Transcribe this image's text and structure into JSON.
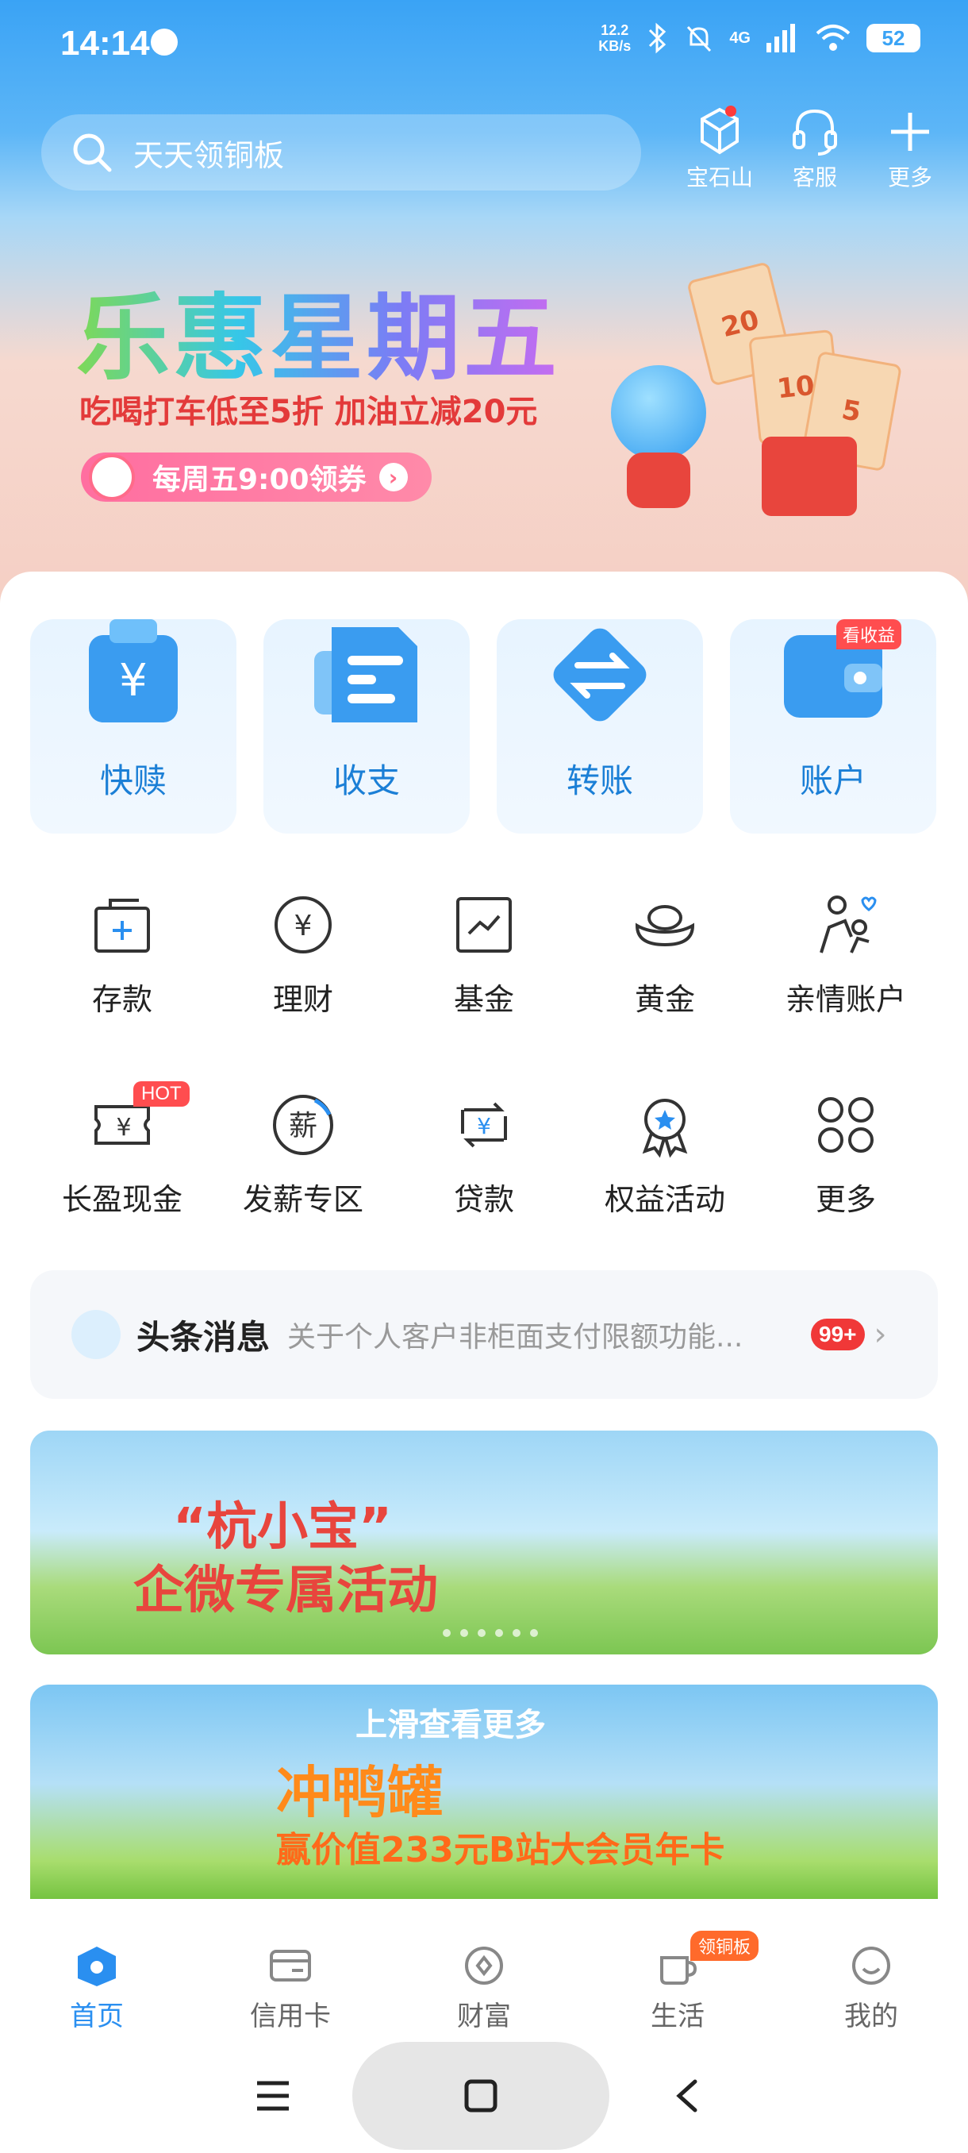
{
  "status_bar": {
    "time": "14:14",
    "net_speed_value": "12.2",
    "net_speed_unit": "KB/s",
    "network": "4G",
    "battery": "52"
  },
  "search": {
    "placeholder": "天天领铜板"
  },
  "top_actions": [
    {
      "label": "宝石山",
      "icon": "gem-mountain-icon"
    },
    {
      "label": "客服",
      "icon": "headset-icon"
    },
    {
      "label": "更多",
      "icon": "plus-icon"
    }
  ],
  "promo": {
    "title": "乐惠星期五",
    "subtitle": "吃喝打车低至5折 加油立减20元",
    "button": "每周五9:00领券",
    "coupons": [
      "20",
      "10",
      "5"
    ]
  },
  "big_tiles": [
    {
      "label": "快赎",
      "icon": "yuan-card-icon"
    },
    {
      "label": "收支",
      "icon": "document-icon"
    },
    {
      "label": "转账",
      "icon": "transfer-icon"
    },
    {
      "label": "账户",
      "icon": "wallet-icon",
      "tag": "看收益"
    }
  ],
  "grid_row1": [
    {
      "label": "存款",
      "icon": "deposit-icon"
    },
    {
      "label": "理财",
      "icon": "wealth-icon"
    },
    {
      "label": "基金",
      "icon": "fund-chart-icon"
    },
    {
      "label": "黄金",
      "icon": "gold-ingot-icon"
    },
    {
      "label": "亲情账户",
      "icon": "family-icon"
    }
  ],
  "grid_row2": [
    {
      "label": "长盈现金",
      "icon": "cash-ticket-icon",
      "tag": "HOT"
    },
    {
      "label": "发薪专区",
      "icon": "salary-icon",
      "glyph": "薪"
    },
    {
      "label": "贷款",
      "icon": "loan-icon"
    },
    {
      "label": "权益活动",
      "icon": "award-icon"
    },
    {
      "label": "更多",
      "icon": "more-grid-icon"
    }
  ],
  "news": {
    "title": "头条消息",
    "message": "关于个人客户非柜面支付限额功能...",
    "badge": "99+"
  },
  "banner1": {
    "line1": "“杭小宝”",
    "line2": "企微专属活动"
  },
  "banner2": {
    "hint": "上滑查看更多",
    "line1": "冲鸭罐",
    "line2": "赢价值233元B站大会员年卡"
  },
  "tabs": [
    {
      "label": "首页",
      "icon": "home-icon",
      "active": true
    },
    {
      "label": "信用卡",
      "icon": "credit-card-icon"
    },
    {
      "label": "财富",
      "icon": "wealth-circle-icon"
    },
    {
      "label": "生活",
      "icon": "cup-icon",
      "badge": "领铜板"
    },
    {
      "label": "我的",
      "icon": "smile-icon"
    }
  ],
  "colors": {
    "primary": "#2a8ff0",
    "header": "#3aa3f5",
    "badge_red": "#f03838"
  }
}
